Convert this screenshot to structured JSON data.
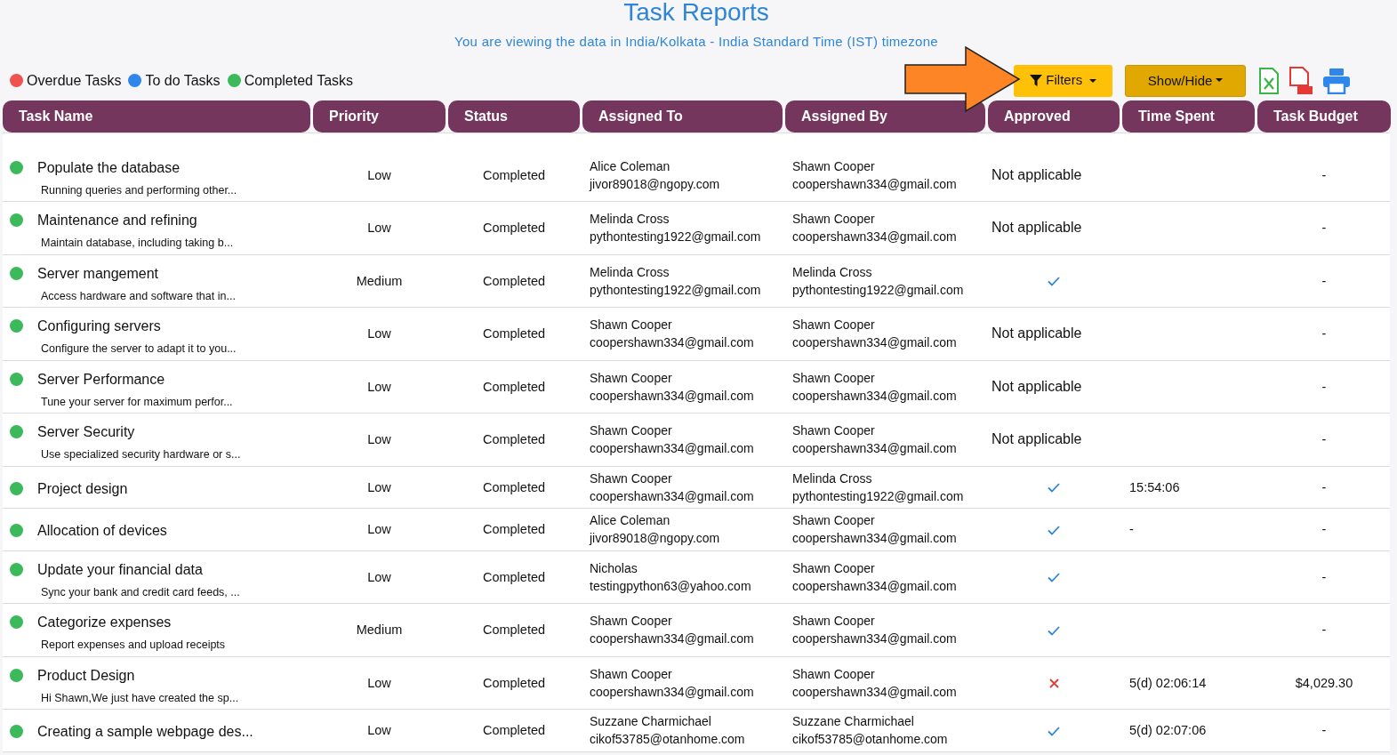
{
  "page": {
    "title": "Task Reports",
    "subtitle": "You are viewing the data in India/Kolkata - India Standard Time (IST) timezone"
  },
  "legend": [
    {
      "label": "Overdue Tasks",
      "color": "#ef5350"
    },
    {
      "label": "To do Tasks",
      "color": "#2f86eb"
    },
    {
      "label": "Completed Tasks",
      "color": "#3cb95a"
    }
  ],
  "toolbar": {
    "filters": "Filters",
    "show_hide": "Show/Hide"
  },
  "table": {
    "columns": [
      "Task Name",
      "Priority",
      "Status",
      "Assigned To",
      "Assigned By",
      "Approved",
      "Time Spent",
      "Task Budget"
    ],
    "rows": [
      {
        "color": "#3cb95a",
        "name": "Populate the database",
        "description": "Running queries and performing other...",
        "priority": "Low",
        "status": "Completed",
        "assigned_to": {
          "name": "Alice Coleman",
          "email": "jivor89018@ngopy.com"
        },
        "assigned_by": {
          "name": "Shawn Cooper",
          "email": "coopershawn334@gmail.com"
        },
        "approved": {
          "kind": "text",
          "text": "Not applicable"
        },
        "budget": "-"
      },
      {
        "color": "#3cb95a",
        "name": "Maintenance and refining",
        "description": "Maintain database, including taking b...",
        "priority": "Low",
        "status": "Completed",
        "assigned_to": {
          "name": "Melinda Cross",
          "email": "pythontesting1922@gmail.com"
        },
        "assigned_by": {
          "name": "Shawn Cooper",
          "email": "coopershawn334@gmail.com"
        },
        "approved": {
          "kind": "text",
          "text": "Not applicable"
        },
        "budget": "-"
      },
      {
        "color": "#3cb95a",
        "name": "Server mangement",
        "description": "Access hardware and software that in...",
        "priority": "Medium",
        "status": "Completed",
        "assigned_to": {
          "name": "Melinda Cross",
          "email": "pythontesting1922@gmail.com"
        },
        "assigned_by": {
          "name": "Melinda Cross",
          "email": "pythontesting1922@gmail.com"
        },
        "approved": {
          "kind": "check"
        },
        "budget": "-"
      },
      {
        "color": "#3cb95a",
        "name": "Configuring servers",
        "description": "Configure the server to adapt it to you...",
        "priority": "Low",
        "status": "Completed",
        "assigned_to": {
          "name": "Shawn Cooper",
          "email": "coopershawn334@gmail.com"
        },
        "assigned_by": {
          "name": "Shawn Cooper",
          "email": "coopershawn334@gmail.com"
        },
        "approved": {
          "kind": "text",
          "text": "Not applicable"
        },
        "budget": "-"
      },
      {
        "color": "#3cb95a",
        "name": "Server Performance",
        "description": "Tune your server for maximum perfor...",
        "priority": "Low",
        "status": "Completed",
        "assigned_to": {
          "name": "Shawn Cooper",
          "email": "coopershawn334@gmail.com"
        },
        "assigned_by": {
          "name": "Shawn Cooper",
          "email": "coopershawn334@gmail.com"
        },
        "approved": {
          "kind": "text",
          "text": "Not applicable"
        },
        "budget": "-"
      },
      {
        "color": "#3cb95a",
        "name": "Server Security",
        "description": "Use specialized security hardware or s...",
        "priority": "Low",
        "status": "Completed",
        "assigned_to": {
          "name": "Shawn Cooper",
          "email": "coopershawn334@gmail.com"
        },
        "assigned_by": {
          "name": "Shawn Cooper",
          "email": "coopershawn334@gmail.com"
        },
        "approved": {
          "kind": "text",
          "text": "Not applicable"
        },
        "budget": "-"
      },
      {
        "color": "#3cb95a",
        "name": "Project design",
        "priority": "Low",
        "status": "Completed",
        "assigned_to": {
          "name": "Shawn Cooper",
          "email": "coopershawn334@gmail.com"
        },
        "assigned_by": {
          "name": "Melinda Cross",
          "email": "pythontesting1922@gmail.com"
        },
        "approved": {
          "kind": "check"
        },
        "time_spent": "15:54:06",
        "budget": "-"
      },
      {
        "color": "#3cb95a",
        "name": "Allocation of devices",
        "priority": "Low",
        "status": "Completed",
        "assigned_to": {
          "name": "Alice Coleman",
          "email": "jivor89018@ngopy.com"
        },
        "assigned_by": {
          "name": "Shawn Cooper",
          "email": "coopershawn334@gmail.com"
        },
        "approved": {
          "kind": "check"
        },
        "time_spent": "-",
        "budget": "-"
      },
      {
        "color": "#3cb95a",
        "name": "Update your financial data",
        "description": "Sync your bank and credit card feeds, ...",
        "priority": "Low",
        "status": "Completed",
        "assigned_to": {
          "name": "Nicholas",
          "email": "testingpython63@yahoo.com"
        },
        "assigned_by": {
          "name": "Shawn Cooper",
          "email": "coopershawn334@gmail.com"
        },
        "approved": {
          "kind": "check"
        },
        "budget": "-"
      },
      {
        "color": "#3cb95a",
        "name": "Categorize expenses",
        "description": "Report expenses and upload receipts",
        "priority": "Medium",
        "status": "Completed",
        "assigned_to": {
          "name": "Shawn Cooper",
          "email": "coopershawn334@gmail.com"
        },
        "assigned_by": {
          "name": "Shawn Cooper",
          "email": "coopershawn334@gmail.com"
        },
        "approved": {
          "kind": "check"
        },
        "budget": "-"
      },
      {
        "color": "#3cb95a",
        "name": "Product Design",
        "description": "Hi Shawn,We just have created the sp...",
        "priority": "Low",
        "status": "Completed",
        "assigned_to": {
          "name": "Shawn Cooper",
          "email": "coopershawn334@gmail.com"
        },
        "assigned_by": {
          "name": "Shawn Cooper",
          "email": "coopershawn334@gmail.com"
        },
        "approved": {
          "kind": "cross"
        },
        "time_spent": "5(d) 02:06:14",
        "budget": "$4,029.30"
      },
      {
        "color": "#3cb95a",
        "name": "Creating a sample webpage des...",
        "priority": "Low",
        "status": "Completed",
        "assigned_to": {
          "name": "Suzzane Charmichael",
          "email": "cikof53785@otanhome.com"
        },
        "assigned_by": {
          "name": "Suzzane Charmichael",
          "email": "cikof53785@otanhome.com"
        },
        "approved": {
          "kind": "check"
        },
        "time_spent": "5(d) 02:07:06",
        "budget": "-"
      }
    ]
  }
}
